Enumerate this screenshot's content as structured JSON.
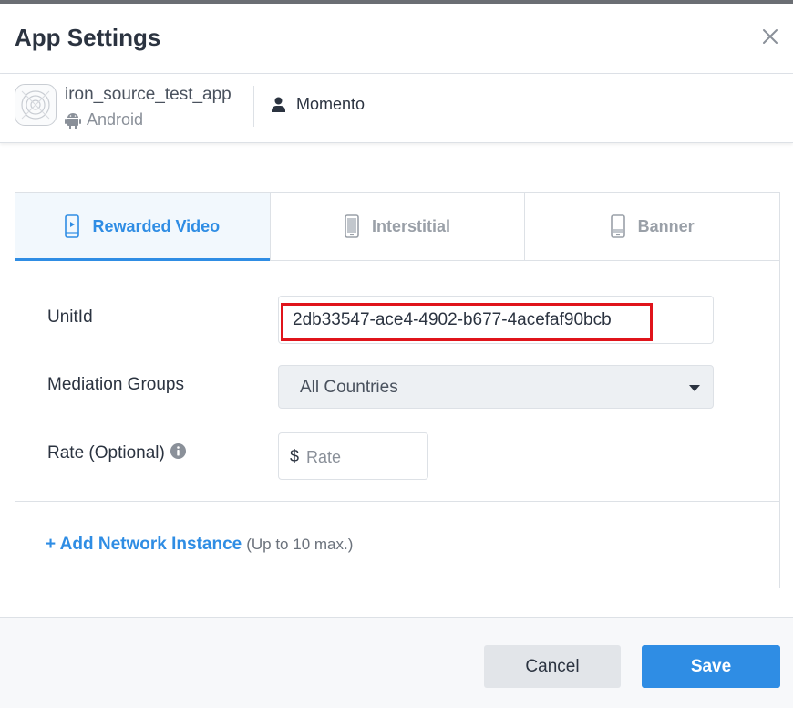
{
  "dialog": {
    "title": "App Settings"
  },
  "app": {
    "name": "iron_source_test_app",
    "platform": "Android",
    "account": "Momento"
  },
  "tabs": [
    {
      "label": "Rewarded Video",
      "active": true,
      "icon": "mobile-video-icon"
    },
    {
      "label": "Interstitial",
      "active": false,
      "icon": "mobile-phone-icon"
    },
    {
      "label": "Banner",
      "active": false,
      "icon": "mobile-banner-icon"
    }
  ],
  "form": {
    "unit_id_label": "UnitId",
    "unit_id_value": "2db33547-ace4-4902-b677-4acefaf90bcb",
    "mediation_label": "Mediation Groups",
    "mediation_value": "All Countries",
    "rate_label": "Rate (Optional)",
    "rate_prefix": "$",
    "rate_placeholder": "Rate",
    "rate_value": ""
  },
  "add_instance": {
    "link": "+ Add Network Instance",
    "hint": "(Up to 10 max.)"
  },
  "footer": {
    "cancel": "Cancel",
    "save": "Save"
  },
  "colors": {
    "accent": "#2f8de4",
    "highlight": "#e0141b",
    "text": "#2b3340"
  }
}
